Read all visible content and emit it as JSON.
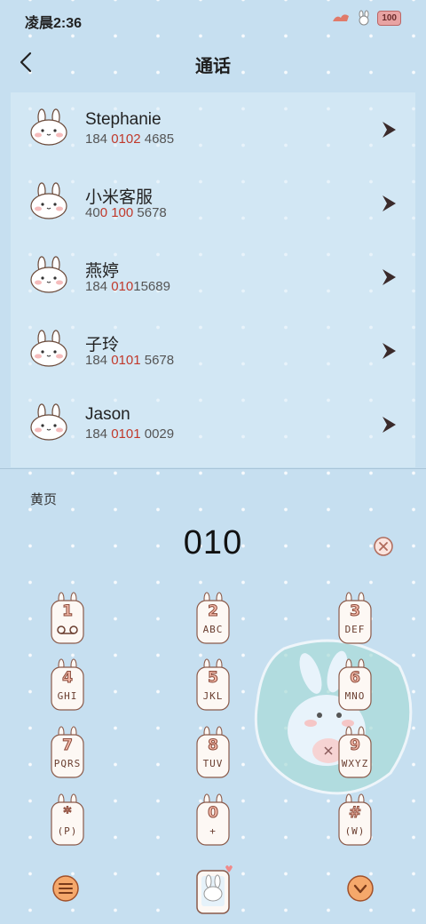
{
  "status_bar": {
    "time": "凌晨2:36",
    "battery": "100"
  },
  "header": {
    "title": "通话"
  },
  "contacts": [
    {
      "name": "Stephanie",
      "phone_pre": "184 ",
      "phone_hl": "0102",
      "phone_post": " 4685"
    },
    {
      "name": "小米客服",
      "phone_pre": "40",
      "phone_hl": "0 100",
      "phone_post": " 5678"
    },
    {
      "name": "燕婷",
      "phone_pre": "184 ",
      "phone_hl": "010",
      "phone_post": "15689"
    },
    {
      "name": "子玲",
      "phone_pre": "184 ",
      "phone_hl": "0101",
      "phone_post": " 5678"
    },
    {
      "name": "Jason",
      "phone_pre": "184 ",
      "phone_hl": "0101",
      "phone_post": " 0029"
    }
  ],
  "section_label": "黄页",
  "dial_input": "010",
  "keypad": [
    {
      "digit": "1",
      "letters": ""
    },
    {
      "digit": "2",
      "letters": "ABC"
    },
    {
      "digit": "3",
      "letters": "DEF"
    },
    {
      "digit": "4",
      "letters": "GHI"
    },
    {
      "digit": "5",
      "letters": "JKL"
    },
    {
      "digit": "6",
      "letters": "MNO"
    },
    {
      "digit": "7",
      "letters": "PQRS"
    },
    {
      "digit": "8",
      "letters": "TUV"
    },
    {
      "digit": "9",
      "letters": "WXYZ"
    },
    {
      "digit": "*",
      "letters": "(P)"
    },
    {
      "digit": "0",
      "letters": "+"
    },
    {
      "digit": "#",
      "letters": "(W)"
    }
  ],
  "colors": {
    "background": "#c6dff0",
    "highlight": "#c0392b",
    "key_fill": "#fdf8f4",
    "accent_orange": "#f5a86b"
  }
}
